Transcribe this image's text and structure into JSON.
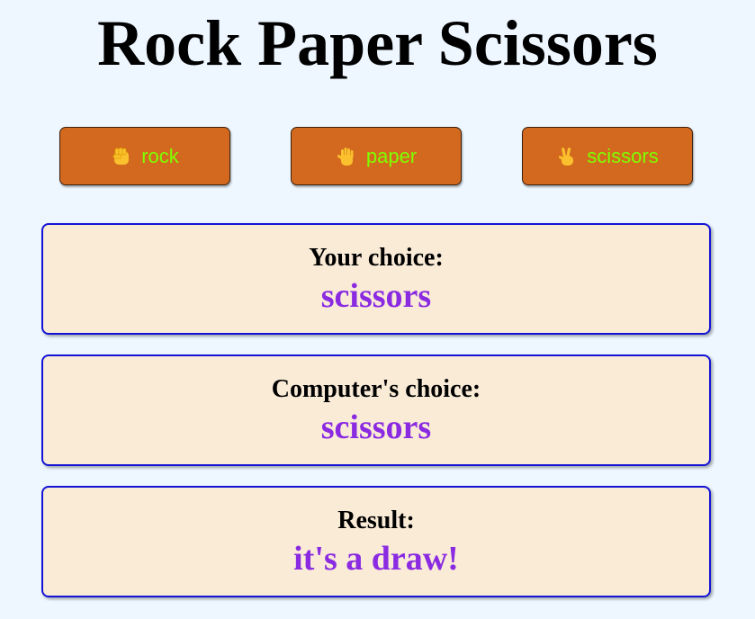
{
  "title": "Rock Paper Scissors",
  "buttons": [
    {
      "label": "rock",
      "icon": "raised-fist-icon"
    },
    {
      "label": "paper",
      "icon": "raised-hand-icon"
    },
    {
      "label": "scissors",
      "icon": "victory-hand-icon"
    }
  ],
  "cards": [
    {
      "label": "Your choice:",
      "value": "scissors"
    },
    {
      "label": "Computer's choice:",
      "value": "scissors"
    },
    {
      "label": "Result:",
      "value": "it's a draw!"
    }
  ],
  "colors": {
    "background": "#eef7ff",
    "button_bg": "#d2691e",
    "button_text": "#7fff00",
    "card_bg": "#faebd7",
    "card_border": "#1414d6",
    "value_text": "#8a2be2",
    "emoji": "#fbc02d"
  }
}
